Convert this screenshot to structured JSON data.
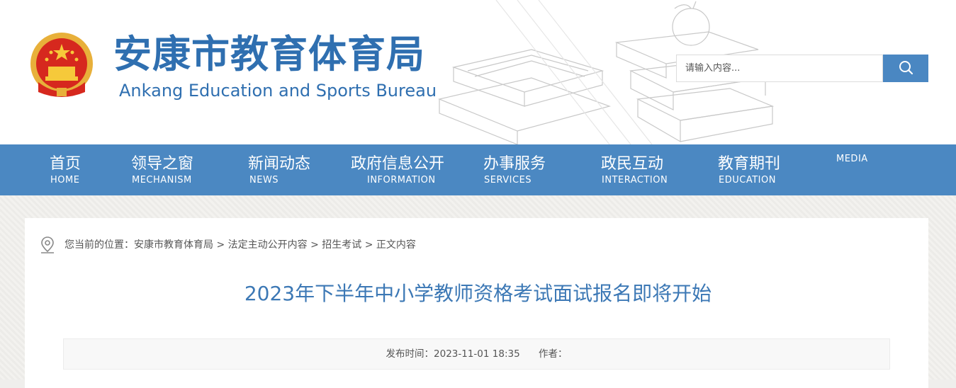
{
  "site": {
    "title_cn": "安康市教育体育局",
    "title_en": "Ankang Education and Sports Bureau",
    "emblem_icon": "national-emblem-icon",
    "brand_color": "#2f6fb0"
  },
  "search": {
    "placeholder": "请输入内容...",
    "button_icon": "search-icon"
  },
  "nav": {
    "background": "#4b88c2",
    "items": [
      {
        "cn": "首页",
        "en": "HOME"
      },
      {
        "cn": "领导之窗",
        "en": "MECHANISM"
      },
      {
        "cn": "新闻动态",
        "en": "NEWS"
      },
      {
        "cn": "政府信息公开",
        "en": "INFORMATION"
      },
      {
        "cn": "办事服务",
        "en": "SERVICES"
      },
      {
        "cn": "政民互动",
        "en": "INTERACTION"
      },
      {
        "cn": "教育期刊",
        "en": "EDUCATION"
      }
    ],
    "extra_label": "MEDIA"
  },
  "breadcrumb": {
    "icon": "location-pin-icon",
    "prefix": "您当前的位置：",
    "items": [
      "安康市教育体育局",
      "法定主动公开内容",
      "招生考试",
      "正文内容"
    ],
    "separator": " > "
  },
  "article": {
    "title": "2023年下半年中小学教师资格考试面试报名即将开始",
    "publish_label": "发布时间：",
    "publish_time": "2023-11-01 18:35",
    "author_label": "作者："
  }
}
